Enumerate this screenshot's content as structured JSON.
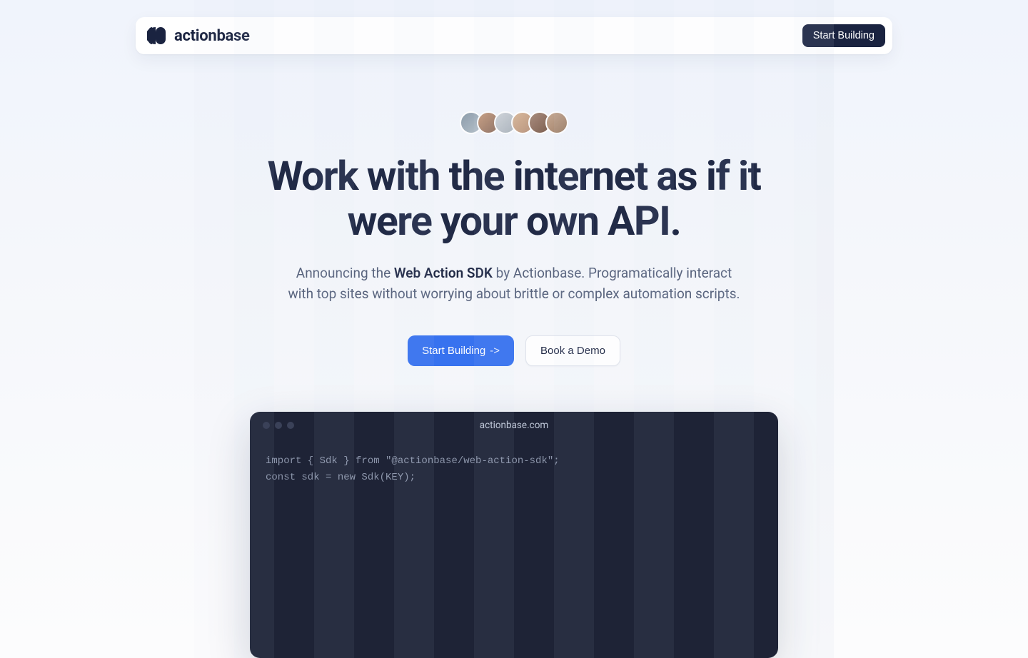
{
  "nav": {
    "brand": "actionbase",
    "cta": "Start Building"
  },
  "hero": {
    "headline": "Work with the internet as if it were your own API.",
    "subhead_prefix": "Announcing the ",
    "subhead_bold": "Web Action SDK",
    "subhead_suffix": " by Actionbase. Programatically interact with top sites without worrying about brittle or complex automation scripts.",
    "primary_cta": "Start Building",
    "primary_cta_arrow": "->",
    "secondary_cta": "Book a Demo"
  },
  "terminal": {
    "title": "actionbase.com",
    "code": "import { Sdk } from \"@actionbase/web-action-sdk\";\nconst sdk = new Sdk(KEY);"
  }
}
